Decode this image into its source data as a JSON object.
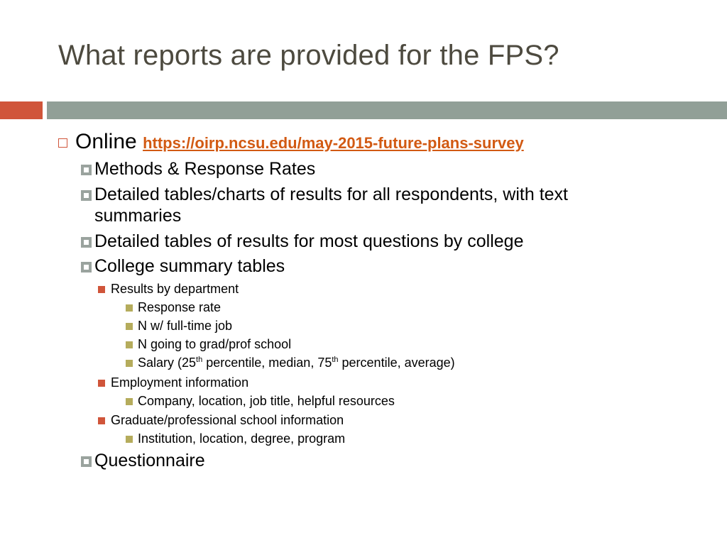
{
  "slide": {
    "title": "What reports are provided for the FPS?",
    "colors": {
      "accent": "#d0553a",
      "bar": "#919f97",
      "link": "#d25a13",
      "level4_bullet": "#b5ac5c",
      "level2_bullet": "#9aa39e"
    }
  },
  "online": {
    "label": "Online",
    "link": "https://oirp.ncsu.edu/may-2015-future-plans-survey",
    "icon": "hollow-square-bullet"
  },
  "level2": {
    "methods": "Methods & Response Rates",
    "detailed_charts_line1": "Detailed tables/charts of results for all respondents, with text",
    "detailed_charts_line2": "summaries",
    "detailed_college": "Detailed tables of results for most questions by college",
    "college_summary": "College summary tables",
    "questionnaire": "Questionnaire"
  },
  "level3": {
    "results_by_dept": "Results by department",
    "employment": "Employment information",
    "grad_school": "Graduate/professional school information"
  },
  "level4": {
    "response_rate": "Response rate",
    "n_job": "N w/ full-time job",
    "n_grad": "N going to grad/prof school",
    "salary_a": "Salary (25",
    "salary_sup1": "th",
    "salary_b": " percentile, median, 75",
    "salary_sup2": "th",
    "salary_c": " percentile, average)",
    "employment_details": "Company, location, job title, helpful resources",
    "grad_details": "Institution, location, degree, program"
  }
}
